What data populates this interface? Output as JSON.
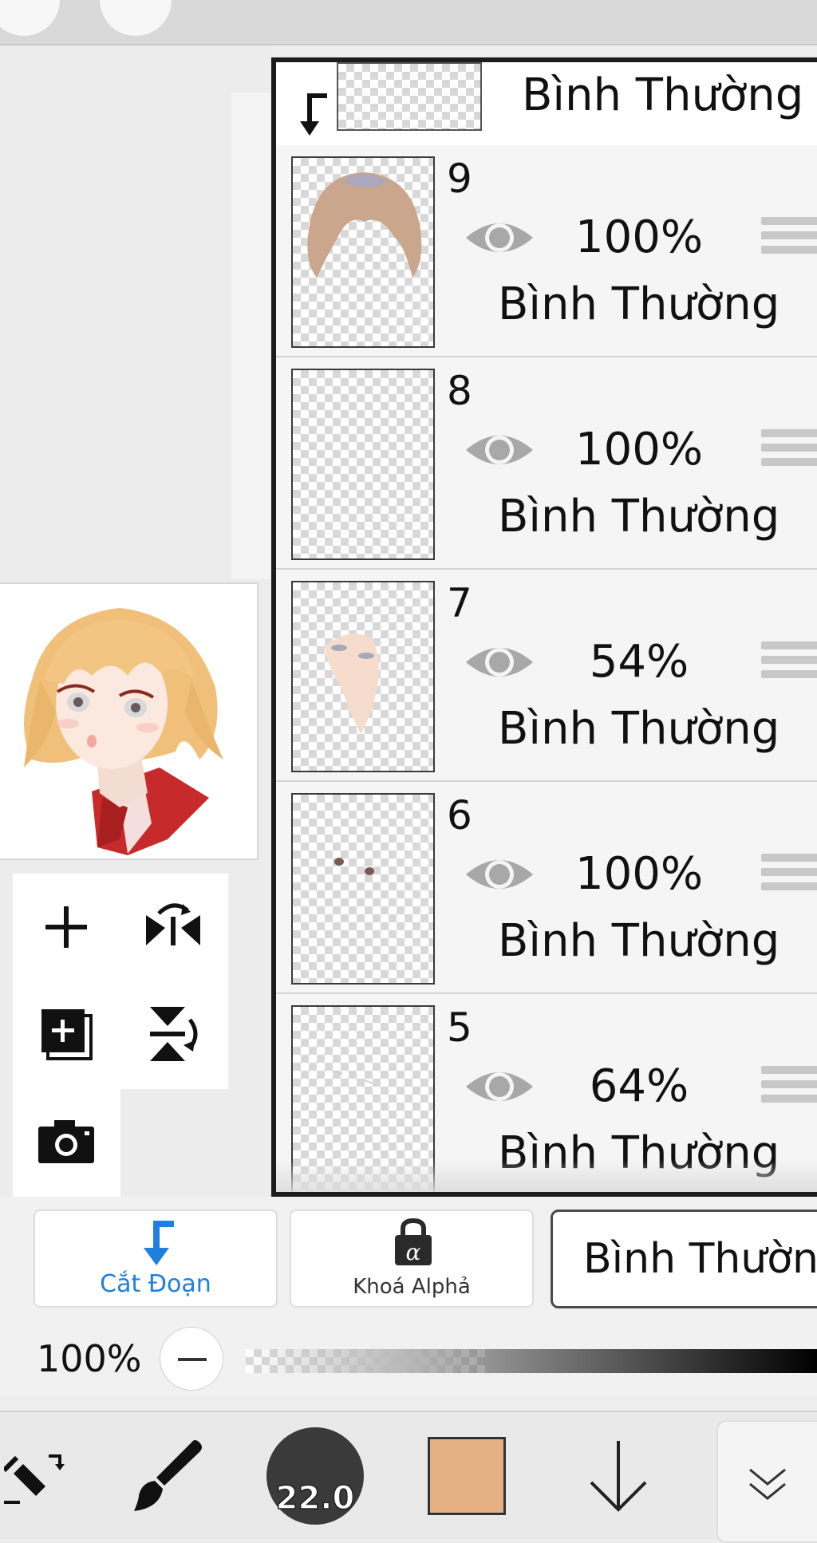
{
  "layer_header": {
    "blend_mode": "Bình Thường"
  },
  "layers": [
    {
      "number": "9",
      "opacity": "100%",
      "blend_mode": "Bình Thường",
      "thumb": "hair"
    },
    {
      "number": "8",
      "opacity": "100%",
      "blend_mode": "Bình Thường",
      "thumb": "empty"
    },
    {
      "number": "7",
      "opacity": "54%",
      "blend_mode": "Bình Thường",
      "thumb": "skin"
    },
    {
      "number": "6",
      "opacity": "100%",
      "blend_mode": "Bình Thường",
      "thumb": "dots"
    },
    {
      "number": "5",
      "opacity": "64%",
      "blend_mode": "Bình Thường",
      "thumb": "faint"
    }
  ],
  "buttons": {
    "clip_label": "Cắt Đoạn",
    "alpha_lock_label": "Khoá Alphả",
    "blend_mode_value": "Bình Thườn"
  },
  "opacity": {
    "label": "100%",
    "value": 1.0
  },
  "brush": {
    "size": "22.0"
  },
  "colors": {
    "current": "#e4b084",
    "accent": "#1e7fe0"
  },
  "icons": {
    "left_tools": [
      "plus-icon",
      "flip-horizontal-icon",
      "add-layer-icon",
      "flip-vertical-icon",
      "camera-icon"
    ],
    "nav": [
      "transform-icon",
      "brush-icon",
      "brush-size",
      "color-swatch",
      "arrow-down-icon",
      "chevron-double-down-icon"
    ]
  }
}
